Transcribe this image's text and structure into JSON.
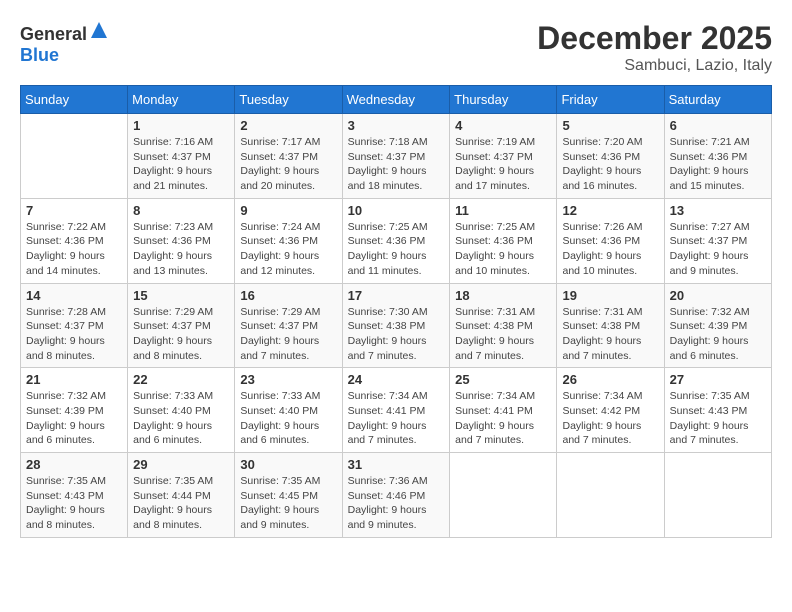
{
  "header": {
    "logo_general": "General",
    "logo_blue": "Blue",
    "month": "December 2025",
    "location": "Sambuci, Lazio, Italy"
  },
  "weekdays": [
    "Sunday",
    "Monday",
    "Tuesday",
    "Wednesday",
    "Thursday",
    "Friday",
    "Saturday"
  ],
  "weeks": [
    [
      {
        "day": "",
        "sunrise": "",
        "sunset": "",
        "daylight": ""
      },
      {
        "day": "1",
        "sunrise": "Sunrise: 7:16 AM",
        "sunset": "Sunset: 4:37 PM",
        "daylight": "Daylight: 9 hours and 21 minutes."
      },
      {
        "day": "2",
        "sunrise": "Sunrise: 7:17 AM",
        "sunset": "Sunset: 4:37 PM",
        "daylight": "Daylight: 9 hours and 20 minutes."
      },
      {
        "day": "3",
        "sunrise": "Sunrise: 7:18 AM",
        "sunset": "Sunset: 4:37 PM",
        "daylight": "Daylight: 9 hours and 18 minutes."
      },
      {
        "day": "4",
        "sunrise": "Sunrise: 7:19 AM",
        "sunset": "Sunset: 4:37 PM",
        "daylight": "Daylight: 9 hours and 17 minutes."
      },
      {
        "day": "5",
        "sunrise": "Sunrise: 7:20 AM",
        "sunset": "Sunset: 4:36 PM",
        "daylight": "Daylight: 9 hours and 16 minutes."
      },
      {
        "day": "6",
        "sunrise": "Sunrise: 7:21 AM",
        "sunset": "Sunset: 4:36 PM",
        "daylight": "Daylight: 9 hours and 15 minutes."
      }
    ],
    [
      {
        "day": "7",
        "sunrise": "Sunrise: 7:22 AM",
        "sunset": "Sunset: 4:36 PM",
        "daylight": "Daylight: 9 hours and 14 minutes."
      },
      {
        "day": "8",
        "sunrise": "Sunrise: 7:23 AM",
        "sunset": "Sunset: 4:36 PM",
        "daylight": "Daylight: 9 hours and 13 minutes."
      },
      {
        "day": "9",
        "sunrise": "Sunrise: 7:24 AM",
        "sunset": "Sunset: 4:36 PM",
        "daylight": "Daylight: 9 hours and 12 minutes."
      },
      {
        "day": "10",
        "sunrise": "Sunrise: 7:25 AM",
        "sunset": "Sunset: 4:36 PM",
        "daylight": "Daylight: 9 hours and 11 minutes."
      },
      {
        "day": "11",
        "sunrise": "Sunrise: 7:25 AM",
        "sunset": "Sunset: 4:36 PM",
        "daylight": "Daylight: 9 hours and 10 minutes."
      },
      {
        "day": "12",
        "sunrise": "Sunrise: 7:26 AM",
        "sunset": "Sunset: 4:36 PM",
        "daylight": "Daylight: 9 hours and 10 minutes."
      },
      {
        "day": "13",
        "sunrise": "Sunrise: 7:27 AM",
        "sunset": "Sunset: 4:37 PM",
        "daylight": "Daylight: 9 hours and 9 minutes."
      }
    ],
    [
      {
        "day": "14",
        "sunrise": "Sunrise: 7:28 AM",
        "sunset": "Sunset: 4:37 PM",
        "daylight": "Daylight: 9 hours and 8 minutes."
      },
      {
        "day": "15",
        "sunrise": "Sunrise: 7:29 AM",
        "sunset": "Sunset: 4:37 PM",
        "daylight": "Daylight: 9 hours and 8 minutes."
      },
      {
        "day": "16",
        "sunrise": "Sunrise: 7:29 AM",
        "sunset": "Sunset: 4:37 PM",
        "daylight": "Daylight: 9 hours and 7 minutes."
      },
      {
        "day": "17",
        "sunrise": "Sunrise: 7:30 AM",
        "sunset": "Sunset: 4:38 PM",
        "daylight": "Daylight: 9 hours and 7 minutes."
      },
      {
        "day": "18",
        "sunrise": "Sunrise: 7:31 AM",
        "sunset": "Sunset: 4:38 PM",
        "daylight": "Daylight: 9 hours and 7 minutes."
      },
      {
        "day": "19",
        "sunrise": "Sunrise: 7:31 AM",
        "sunset": "Sunset: 4:38 PM",
        "daylight": "Daylight: 9 hours and 7 minutes."
      },
      {
        "day": "20",
        "sunrise": "Sunrise: 7:32 AM",
        "sunset": "Sunset: 4:39 PM",
        "daylight": "Daylight: 9 hours and 6 minutes."
      }
    ],
    [
      {
        "day": "21",
        "sunrise": "Sunrise: 7:32 AM",
        "sunset": "Sunset: 4:39 PM",
        "daylight": "Daylight: 9 hours and 6 minutes."
      },
      {
        "day": "22",
        "sunrise": "Sunrise: 7:33 AM",
        "sunset": "Sunset: 4:40 PM",
        "daylight": "Daylight: 9 hours and 6 minutes."
      },
      {
        "day": "23",
        "sunrise": "Sunrise: 7:33 AM",
        "sunset": "Sunset: 4:40 PM",
        "daylight": "Daylight: 9 hours and 6 minutes."
      },
      {
        "day": "24",
        "sunrise": "Sunrise: 7:34 AM",
        "sunset": "Sunset: 4:41 PM",
        "daylight": "Daylight: 9 hours and 7 minutes."
      },
      {
        "day": "25",
        "sunrise": "Sunrise: 7:34 AM",
        "sunset": "Sunset: 4:41 PM",
        "daylight": "Daylight: 9 hours and 7 minutes."
      },
      {
        "day": "26",
        "sunrise": "Sunrise: 7:34 AM",
        "sunset": "Sunset: 4:42 PM",
        "daylight": "Daylight: 9 hours and 7 minutes."
      },
      {
        "day": "27",
        "sunrise": "Sunrise: 7:35 AM",
        "sunset": "Sunset: 4:43 PM",
        "daylight": "Daylight: 9 hours and 7 minutes."
      }
    ],
    [
      {
        "day": "28",
        "sunrise": "Sunrise: 7:35 AM",
        "sunset": "Sunset: 4:43 PM",
        "daylight": "Daylight: 9 hours and 8 minutes."
      },
      {
        "day": "29",
        "sunrise": "Sunrise: 7:35 AM",
        "sunset": "Sunset: 4:44 PM",
        "daylight": "Daylight: 9 hours and 8 minutes."
      },
      {
        "day": "30",
        "sunrise": "Sunrise: 7:35 AM",
        "sunset": "Sunset: 4:45 PM",
        "daylight": "Daylight: 9 hours and 9 minutes."
      },
      {
        "day": "31",
        "sunrise": "Sunrise: 7:36 AM",
        "sunset": "Sunset: 4:46 PM",
        "daylight": "Daylight: 9 hours and 9 minutes."
      },
      {
        "day": "",
        "sunrise": "",
        "sunset": "",
        "daylight": ""
      },
      {
        "day": "",
        "sunrise": "",
        "sunset": "",
        "daylight": ""
      },
      {
        "day": "",
        "sunrise": "",
        "sunset": "",
        "daylight": ""
      }
    ]
  ]
}
